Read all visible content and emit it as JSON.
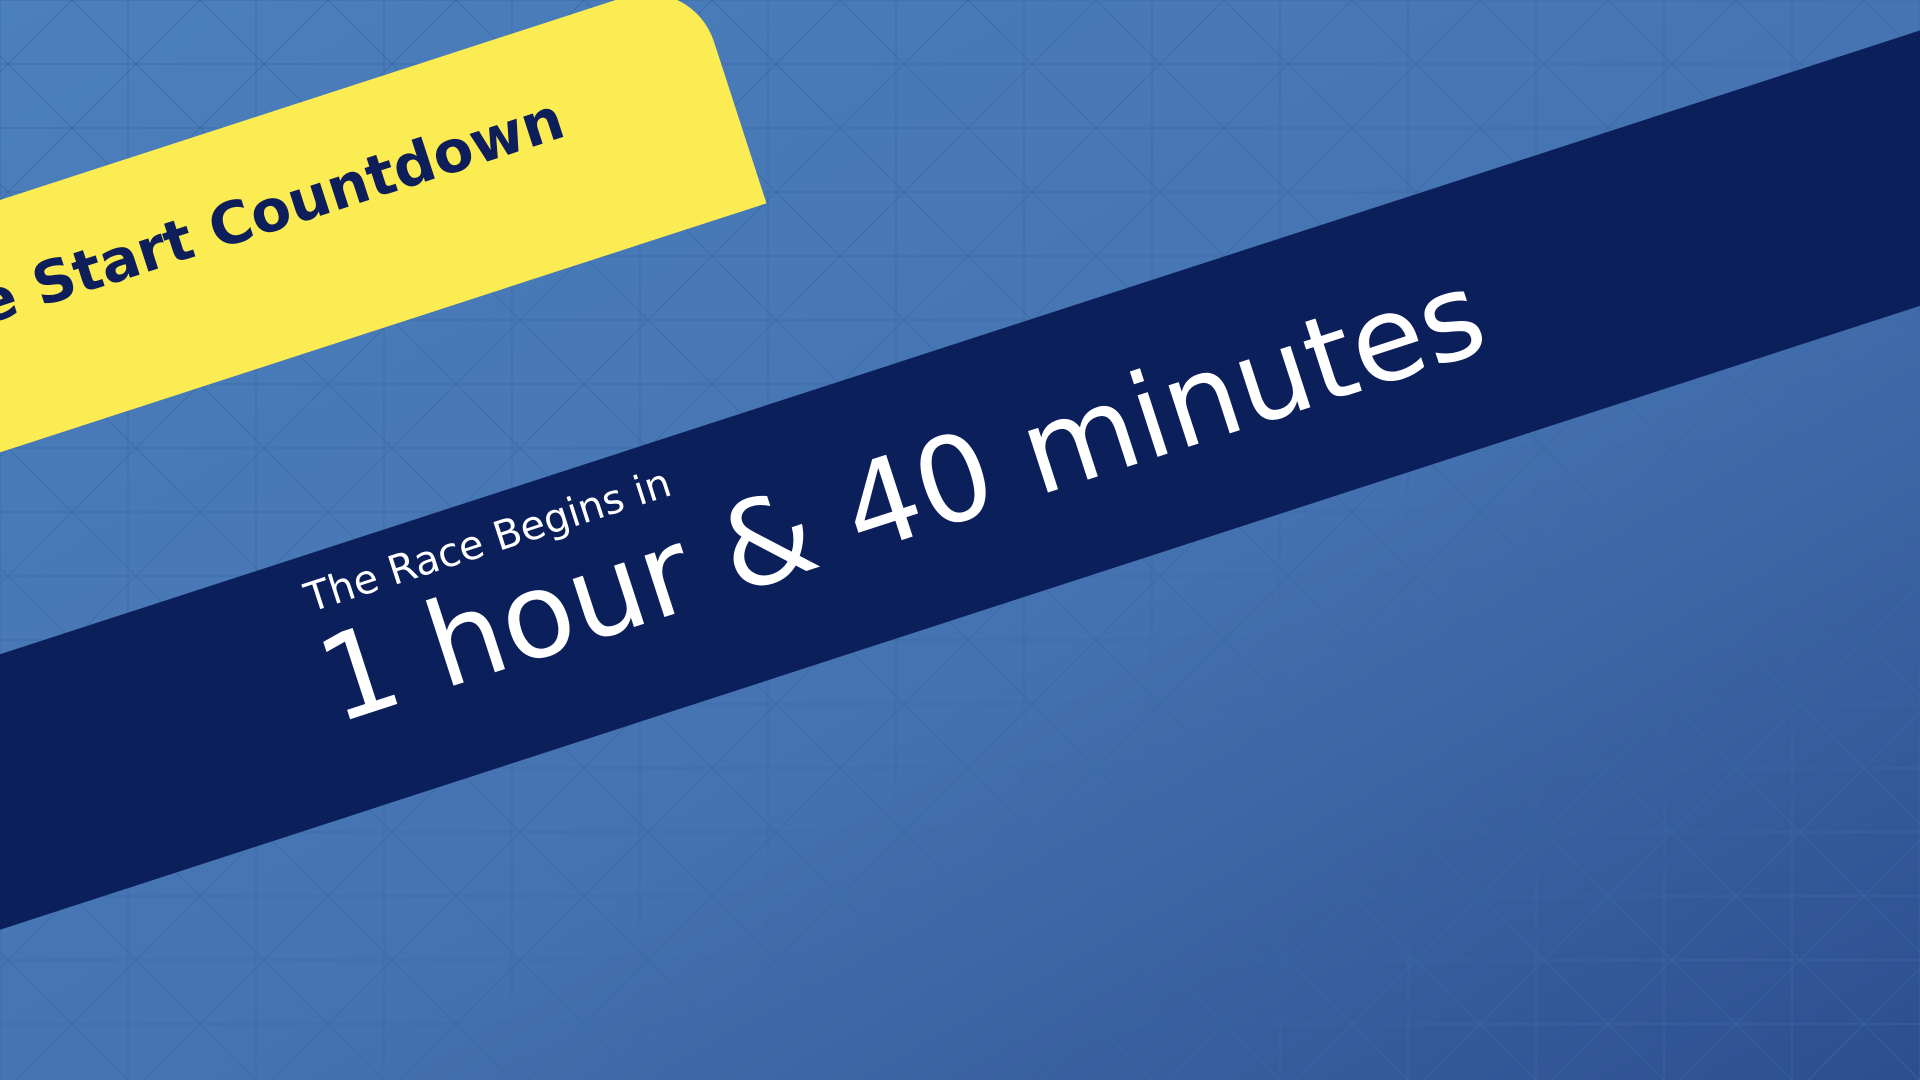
{
  "header": {
    "title": "Race Start Countdown"
  },
  "countdown": {
    "intro": "The Race Begins in",
    "time_remaining": "1 hour & 40 minutes"
  },
  "colors": {
    "background_top": "#4c7fbd",
    "background_bottom": "#2c4e8f",
    "grid_line": "#3a69a4",
    "accent_yellow": "#fbec53",
    "band_navy": "#0b1f5b",
    "title_text": "#0d1e5a",
    "countdown_text": "#ffffff"
  }
}
